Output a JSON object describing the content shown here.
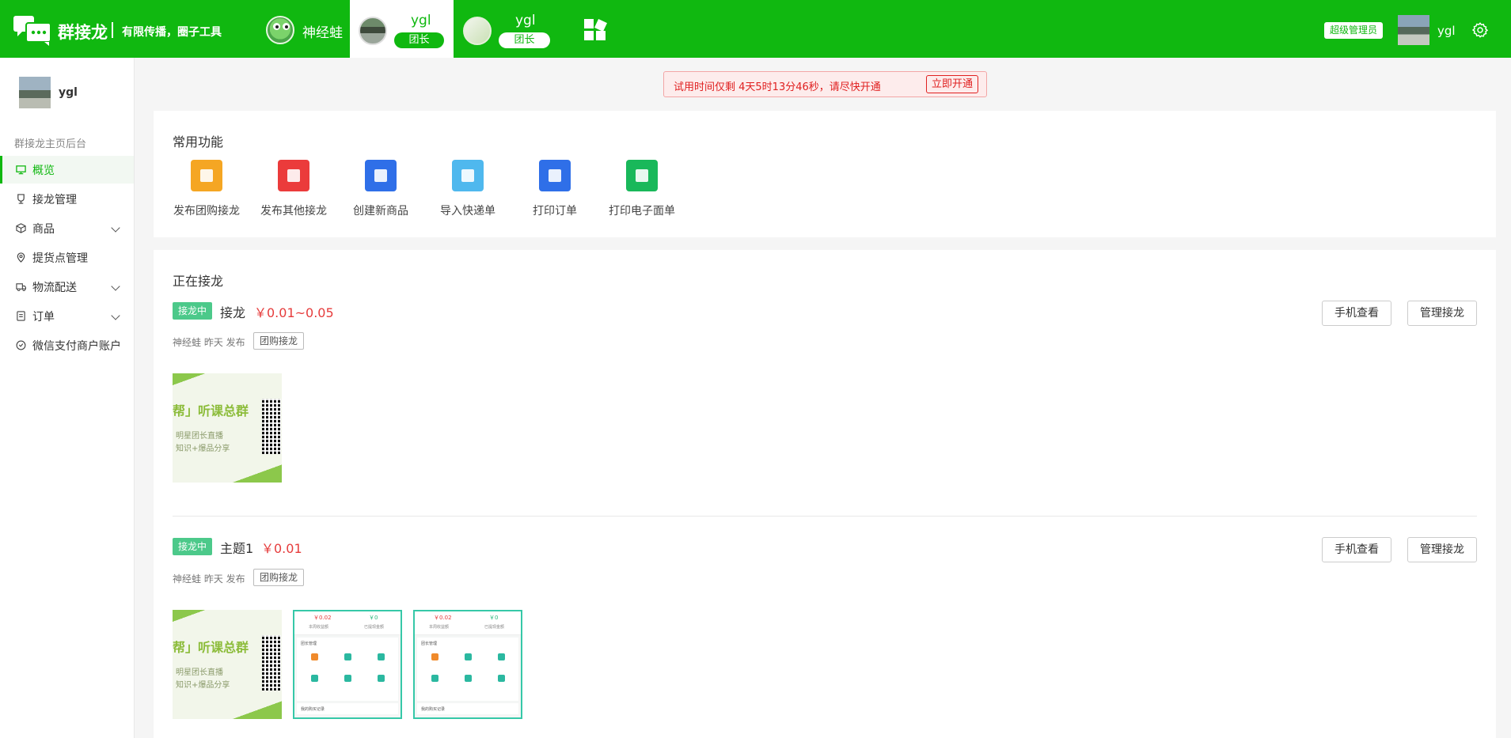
{
  "header": {
    "brand": "群接龙",
    "slogan": "有限传播，圈子工具",
    "groups": [
      {
        "name": "神经蛙"
      },
      {
        "name": "ygl",
        "role": "团长",
        "active": true
      },
      {
        "name": "ygl",
        "role": "团长"
      }
    ],
    "admin_badge": "超级管理员",
    "user": "ygl",
    "icons": [
      "chat-logo-icon",
      "grid-apps-icon",
      "gear-icon"
    ],
    "accent": "#10b810"
  },
  "sidebar": {
    "user": "ygl",
    "section": "群接龙主页后台",
    "items": [
      {
        "label": "概览",
        "icon": "monitor-icon",
        "active": true
      },
      {
        "label": "接龙管理",
        "icon": "trophy-icon"
      },
      {
        "label": "商品",
        "icon": "box-icon",
        "expandable": true
      },
      {
        "label": "提货点管理",
        "icon": "location-pin-icon"
      },
      {
        "label": "物流配送",
        "icon": "truck-icon",
        "expandable": true
      },
      {
        "label": "订单",
        "icon": "receipt-icon",
        "expandable": true
      },
      {
        "label": "微信支付商户账户",
        "icon": "wallet-icon"
      }
    ]
  },
  "trial": {
    "text": "试用时间仅剩 4天5时13分46秒，请尽快开通",
    "button": "立即开通"
  },
  "functions": {
    "title": "常用功能",
    "items": [
      {
        "label": "发布团购接龙",
        "icon": "publish-group-icon",
        "color": "#f5a623"
      },
      {
        "label": "发布其他接龙",
        "icon": "publish-other-icon",
        "color": "#eb3b3b"
      },
      {
        "label": "创建新商品",
        "icon": "create-product-icon",
        "color": "#2f6fe8"
      },
      {
        "label": "导入快递单",
        "icon": "import-waybill-icon",
        "color": "#4fb8ee"
      },
      {
        "label": "打印订单",
        "icon": "printer-icon",
        "color": "#2f6fe8"
      },
      {
        "label": "打印电子面单",
        "icon": "e-waybill-icon",
        "color": "#19b85a"
      }
    ]
  },
  "ongoing": {
    "title": "正在接龙",
    "items": [
      {
        "tag": "接龙中",
        "title": "接龙",
        "price": "￥0.01~0.05",
        "meta": "神经蛙 昨天 发布",
        "type": "团购接龙",
        "view_button": "手机查看",
        "manage_button": "管理接龙",
        "thumb": {
          "title": "帮」听课总群",
          "line1": "明星团长直播",
          "line2": "知识+爆品分享"
        }
      },
      {
        "tag": "接龙中",
        "title": "主题1",
        "price": "￥0.01",
        "meta": "神经蛙 昨天 发布",
        "type": "团购接龙",
        "view_button": "手机查看",
        "manage_button": "管理接龙",
        "thumb": {
          "title": "帮」听课总群",
          "line1": "明星团长直播",
          "line2": "知识+爆品分享"
        },
        "app_thumbs": [
          {
            "v1": "￥0.02",
            "v2": "￥0",
            "l1": "本周收益额",
            "l2": "已提现金额",
            "panel": "团长管理",
            "foot": "我的购买记录"
          },
          {
            "v1": "￥0.02",
            "v2": "￥0",
            "l1": "本周收益额",
            "l2": "已提现金额",
            "panel": "团长管理",
            "foot": "我的购买记录"
          }
        ]
      }
    ]
  }
}
